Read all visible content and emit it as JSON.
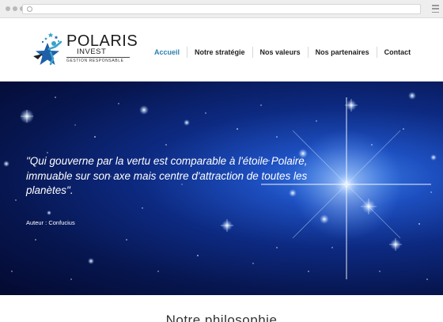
{
  "brand": {
    "name": "POLARIS",
    "sub": "INVEST",
    "tagline": "GESTION RESPONSABLE",
    "colors": {
      "accent": "#2a7fb5",
      "logo_blue": "#1e5fa8",
      "logo_teal": "#3aa3c9"
    }
  },
  "nav": {
    "items": [
      {
        "label": "Accueil",
        "active": true
      },
      {
        "label": "Notre stratégie",
        "active": false
      },
      {
        "label": "Nos valeurs",
        "active": false
      },
      {
        "label": "Nos partenaires",
        "active": false
      },
      {
        "label": "Contact",
        "active": false
      }
    ]
  },
  "hero": {
    "quote": "\"Qui gouverne par la vertu est comparable à l'étoile Polaire, immuable sur son axe mais centre d'attraction de toutes les planètes\".",
    "author": "Auteur : Confucius"
  },
  "section": {
    "title": "Notre philosophie"
  },
  "icons": {
    "browser": [
      "window-dot-icon",
      "address-circle-icon",
      "hamburger-menu-icon"
    ],
    "logo": "star-figure-logo-icon"
  }
}
